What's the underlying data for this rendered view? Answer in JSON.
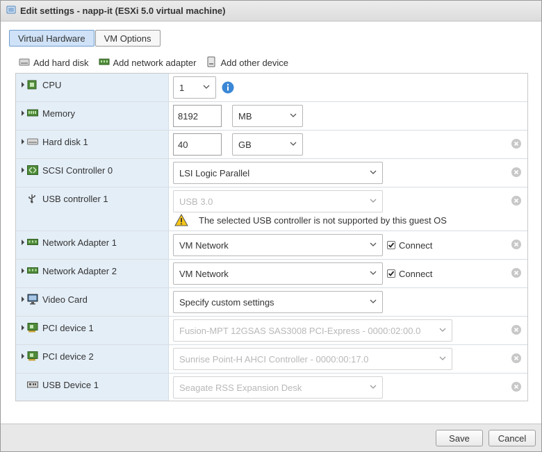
{
  "window": {
    "title": "Edit settings - napp-it (ESXi 5.0 virtual machine)"
  },
  "tabs": [
    {
      "label": "Virtual Hardware",
      "active": true
    },
    {
      "label": "VM Options",
      "active": false
    }
  ],
  "toolbar": {
    "add_hard_disk": "Add hard disk",
    "add_network_adapter": "Add network adapter",
    "add_other_device": "Add other device"
  },
  "hardware": {
    "cpu": {
      "label": "CPU",
      "value": "1"
    },
    "memory": {
      "label": "Memory",
      "value": "8192",
      "unit": "MB"
    },
    "hard_disk_1": {
      "label": "Hard disk 1",
      "value": "40",
      "unit": "GB"
    },
    "scsi": {
      "label": "SCSI Controller 0",
      "value": "LSI Logic Parallel"
    },
    "usb_controller": {
      "label": "USB controller 1",
      "value": "USB 3.0",
      "warning": "The selected USB controller is not supported by this guest OS"
    },
    "net1": {
      "label": "Network Adapter 1",
      "value": "VM Network",
      "connect_label": "Connect",
      "connected": true
    },
    "net2": {
      "label": "Network Adapter 2",
      "value": "VM Network",
      "connect_label": "Connect",
      "connected": true
    },
    "video": {
      "label": "Video Card",
      "value": "Specify custom settings"
    },
    "pci1": {
      "label": "PCI device 1",
      "value": "Fusion-MPT 12GSAS SAS3008 PCI-Express - 0000:02:00.0"
    },
    "pci2": {
      "label": "PCI device 2",
      "value": "Sunrise Point-H AHCI Controller - 0000:00:17.0"
    },
    "usb_device": {
      "label": "USB Device 1",
      "value": "Seagate RSS Expansion Desk"
    }
  },
  "footer": {
    "save_label": "Save",
    "cancel_label": "Cancel"
  },
  "colors": {
    "left_column": "#e4eef7",
    "tab_active": "#cfe2f7",
    "footer": "#e8e8e8",
    "info": "#3a87d6"
  }
}
